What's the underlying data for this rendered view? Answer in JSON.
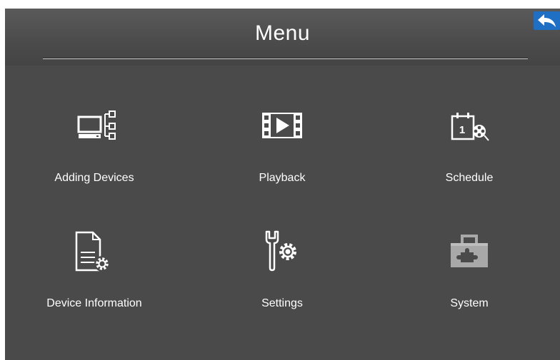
{
  "header": {
    "title": "Menu"
  },
  "back_button": {
    "icon": "back-arrow-icon",
    "color": "#1f6fc4"
  },
  "menu_items": [
    {
      "label": "Adding Devices",
      "icon": "network-devices-icon"
    },
    {
      "label": "Playback",
      "icon": "film-play-icon"
    },
    {
      "label": "Schedule",
      "icon": "calendar-reel-icon"
    },
    {
      "label": "Device Information",
      "icon": "document-gear-icon"
    },
    {
      "label": "Settings",
      "icon": "wrench-gear-icon"
    },
    {
      "label": "System",
      "icon": "toolbox-icon"
    }
  ],
  "colors": {
    "background": "#4a4a4a",
    "text": "#ffffff",
    "accent": "#1f6fc4"
  }
}
